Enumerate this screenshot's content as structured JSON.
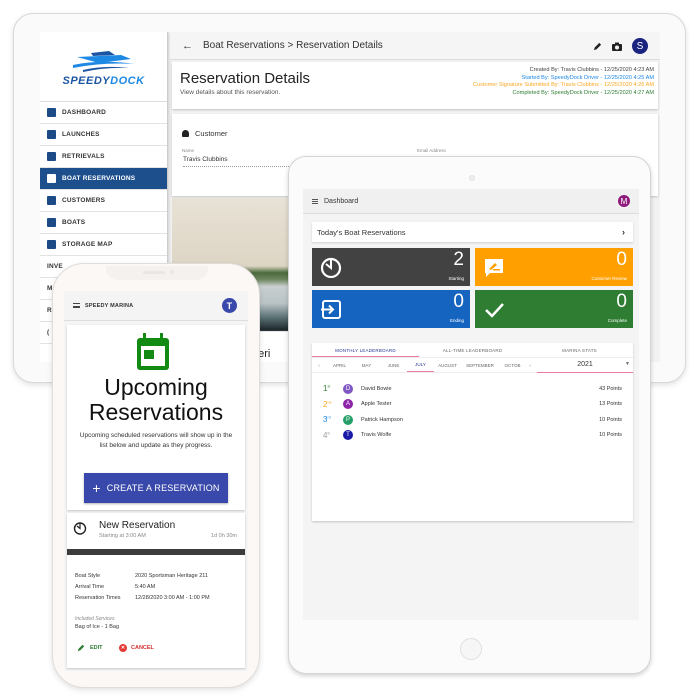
{
  "desktop": {
    "logo": {
      "part1": "SPEEDY",
      "part2": "DOCK"
    },
    "sidebar": {
      "items": [
        {
          "label": "DASHBOARD",
          "icon": "dashboard-icon",
          "active": false
        },
        {
          "label": "LAUNCHES",
          "icon": "launch-icon",
          "active": false
        },
        {
          "label": "RETRIEVALS",
          "icon": "clipboard-icon",
          "active": false
        },
        {
          "label": "BOAT RESERVATIONS",
          "icon": "calendar-icon",
          "active": true
        },
        {
          "label": "CUSTOMERS",
          "icon": "people-icon",
          "active": false
        },
        {
          "label": "BOATS",
          "icon": "boat-icon",
          "active": false
        },
        {
          "label": "STORAGE MAP",
          "icon": "map-icon",
          "active": false
        },
        {
          "label": "INVE",
          "icon": "",
          "active": false
        },
        {
          "label": "M",
          "icon": "",
          "active": false
        },
        {
          "label": "R",
          "icon": "",
          "active": false
        },
        {
          "label": "(",
          "icon": "",
          "active": false
        }
      ]
    },
    "topbar": {
      "back_icon": "←",
      "breadcrumb": "Boat Reservations > Reservation Details",
      "avatar_letter": "S"
    },
    "header": {
      "title": "Reservation Details",
      "subtitle": "View details about this reservation.",
      "audit": [
        {
          "text": "Created By: Travis Clubbins - 12/25/2020 4:23 AM",
          "color": "#444444"
        },
        {
          "text": "Started By: SpeedyDock Driver - 12/25/2020 4:25 AM",
          "color": "#1e88e5"
        },
        {
          "text": "Customer Signature Submitted By: Travis Clubbins - 12/25/2020 4:26 AM",
          "color": "#f9a825"
        },
        {
          "text": "Completed By: SpeedyDock Driver - 12/25/2020 4:27 AM",
          "color": "#2e7d32"
        }
      ]
    },
    "customer": {
      "heading": "Customer",
      "name_label": "Name",
      "name_value": "Travis Clubbins",
      "email_label": "Email Address"
    },
    "photo_caption": "n Heri"
  },
  "tablet": {
    "topbar": {
      "title": "Dashboard",
      "avatar_letter": "M"
    },
    "today": {
      "label": "Today's Boat Reservations",
      "chevron": "›"
    },
    "tiles": [
      {
        "value": "2",
        "label": "Starting",
        "color": "#424242",
        "icon": "timer-icon"
      },
      {
        "value": "0",
        "label": "Customer Review",
        "color": "#ffa000",
        "icon": "signature-icon"
      },
      {
        "value": "0",
        "label": "Ending",
        "color": "#1565c0",
        "icon": "enter-icon"
      },
      {
        "value": "0",
        "label": "Complete",
        "color": "#2e7d32",
        "icon": "check-icon"
      }
    ],
    "leaderboard": {
      "tabs": [
        {
          "label": "MONTHLY LEADERBOARD",
          "active": true
        },
        {
          "label": "ALL-TIME LEADERBOARD",
          "active": false
        },
        {
          "label": "MARINA STATS",
          "active": false
        }
      ],
      "prev": "‹",
      "next": "›",
      "months": [
        "APRIL",
        "MAY",
        "JUNE",
        "JULY",
        "AUGUST",
        "SEPTEMBER",
        "OCTOB"
      ],
      "active_month": "JULY",
      "year": "2021",
      "entries": [
        {
          "rank": "1",
          "suffix": "st",
          "rank_color": "#2e7d32",
          "initial": "D",
          "avatar_color": "#7e57c2",
          "name": "David Bowie",
          "points": "43 Points"
        },
        {
          "rank": "2",
          "suffix": "nd",
          "rank_color": "#f9a825",
          "initial": "A",
          "avatar_color": "#8e24aa",
          "name": "Apple Tester",
          "points": "13 Points"
        },
        {
          "rank": "3",
          "suffix": "rd",
          "rank_color": "#1e88e5",
          "initial": "P",
          "avatar_color": "#26a069",
          "name": "Patrick Hampson",
          "points": "10 Points"
        },
        {
          "rank": "4",
          "suffix": "th",
          "rank_color": "#9e9e9e",
          "initial": "T",
          "avatar_color": "#1a1aa6",
          "name": "Travis Wolfe",
          "points": "10 Points"
        }
      ]
    }
  },
  "phone": {
    "topbar": {
      "title": "SPEEDY MARINA",
      "avatar_letter": "T"
    },
    "hero": {
      "title_line1": "Upcoming",
      "title_line2": "Reservations",
      "description": "Upcoming scheduled reservations will show up in the list below and update as they progress.",
      "button_plus": "+",
      "button_label": "CREATE A RESERVATION"
    },
    "reservation": {
      "title": "New Reservation",
      "subtitle": "Starting at 3:00 AM",
      "duration": "1d 0h 30m",
      "details": [
        {
          "key": "Boat Style",
          "value": "2020 Sportsman Heritage 211"
        },
        {
          "key": "Arrival Time",
          "value": "5:40 AM"
        },
        {
          "key": "Reservation Times",
          "value": "12/28/2020 3:00 AM - 1:00 PM"
        }
      ],
      "services_label": "Included Services",
      "services_value": "Bag of Ice - 1 Bag",
      "edit_label": "EDIT",
      "cancel_label": "CANCEL"
    }
  }
}
